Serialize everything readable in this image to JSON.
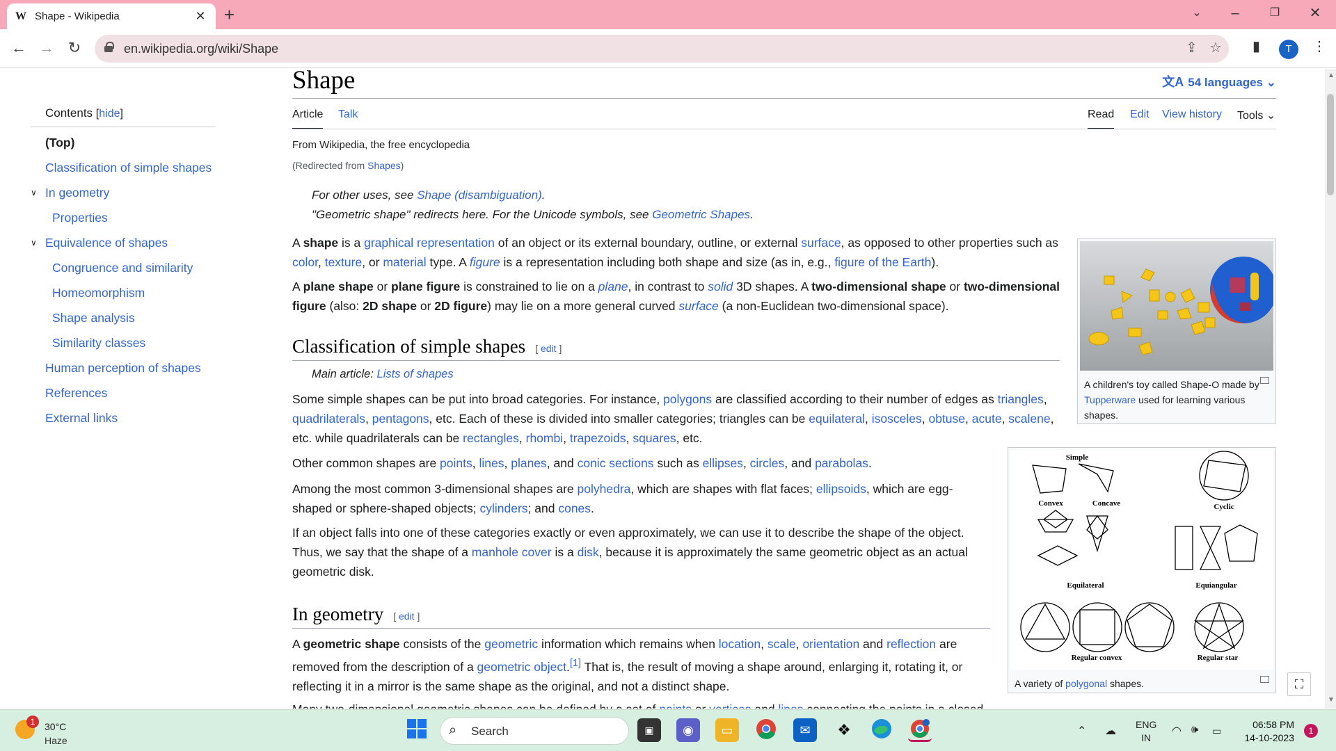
{
  "browser": {
    "tab_title": "Shape - Wikipedia",
    "tab_favicon": "W",
    "url": "en.wikipedia.org/wiki/Shape",
    "profile_initial": "T",
    "accent_color": "#f7a9b9"
  },
  "toc": {
    "heading": "Contents",
    "hide_label": "hide",
    "items": [
      {
        "label": "(Top)"
      },
      {
        "label": "Classification of simple shapes"
      },
      {
        "label": "In geometry"
      },
      {
        "label": "Properties"
      },
      {
        "label": "Equivalence of shapes"
      },
      {
        "label": "Congruence and similarity"
      },
      {
        "label": "Homeomorphism"
      },
      {
        "label": "Shape analysis"
      },
      {
        "label": "Similarity classes"
      },
      {
        "label": "Human perception of shapes"
      },
      {
        "label": "References"
      },
      {
        "label": "External links"
      }
    ]
  },
  "article": {
    "title": "Shape",
    "languages": "54 languages",
    "tabs": {
      "article": "Article",
      "talk": "Talk",
      "read": "Read",
      "edit": "Edit",
      "history": "View history",
      "tools": "Tools"
    },
    "tagline": "From Wikipedia, the free encyclopedia",
    "redirected_prefix": "(Redirected from ",
    "redirected_link": "Shapes",
    "redirected_suffix": ")",
    "hatnote1_prefix": "For other uses, see ",
    "hatnote1_link": "Shape (disambiguation)",
    "hatnote1_suffix": ".",
    "hatnote2_prefix": "\"Geometric shape\" redirects here. For the Unicode symbols, see ",
    "hatnote2_link": "Geometric Shapes",
    "hatnote2_suffix": ".",
    "section1_title": "Classification of simple shapes",
    "section2_title": "In geometry",
    "edit_label": "edit",
    "main_article_prefix": "Main article: ",
    "main_article_link": "Lists of shapes",
    "image1_caption_prefix": "A children's toy called Shape-O made by ",
    "image1_caption_link": "Tupperware",
    "image1_caption_suffix": " used for learning various shapes.",
    "image2_caption_prefix": "A variety of ",
    "image2_caption_link": "polygonal",
    "image2_caption_suffix": " shapes.",
    "diagram_labels": {
      "simple": "Simple",
      "convex": "Convex",
      "concave": "Concave",
      "cyclic": "Cyclic",
      "equilateral": "Equilateral",
      "equiangular": "Equiangular",
      "regular_convex": "Regular convex",
      "regular_star": "Regular star"
    }
  },
  "taskbar": {
    "weather_badge": "1",
    "temperature": "30°C",
    "condition": "Haze",
    "search_placeholder": "Search",
    "language": "ENG",
    "region": "IN",
    "time": "06:58 PM",
    "date": "14-10-2023",
    "notification_count": "1"
  }
}
